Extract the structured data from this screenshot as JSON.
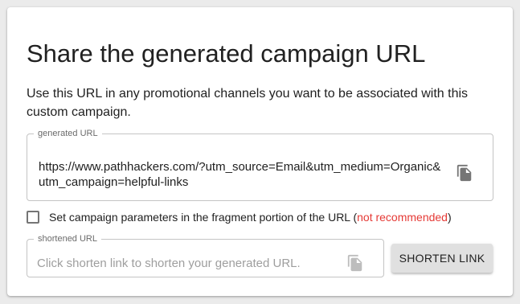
{
  "card": {
    "title": "Share the generated campaign URL",
    "description": "Use this URL in any promotional channels you want to be associated with this custom campaign."
  },
  "generated_url": {
    "legend": "generated URL",
    "value": "https://www.pathhackers.com/?utm_source=Email&utm_medium=Organic&utm_campaign=helpful-links",
    "copy_icon": "copy-icon"
  },
  "fragment_option": {
    "label": "Set campaign parameters in the fragment portion of the URL (",
    "warning": "not recommended",
    "label_end": ")",
    "checked": false
  },
  "shortened_url": {
    "legend": "shortened URL",
    "placeholder": "Click shorten link to shorten your generated URL.",
    "copy_icon": "copy-icon"
  },
  "shorten_button": {
    "label": "SHORTEN LINK"
  },
  "colors": {
    "warning": "#e53935",
    "icon_active": "#757575",
    "icon_disabled": "#bdbdbd"
  }
}
